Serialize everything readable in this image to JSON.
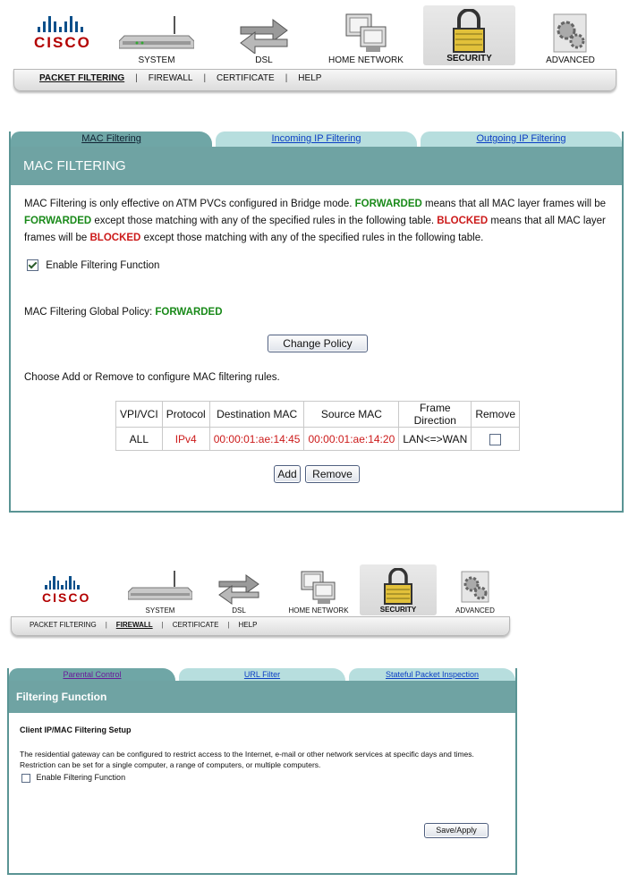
{
  "top": {
    "logo": {
      "icon": "cisco-logo-icon",
      "word": "CISCO"
    },
    "nav": [
      {
        "label": "SYSTEM",
        "icon": "router-icon"
      },
      {
        "label": "DSL",
        "icon": "arrows-icon"
      },
      {
        "label": "HOME NETWORK",
        "icon": "computers-icon"
      },
      {
        "label": "SECURITY",
        "icon": "padlock-icon"
      },
      {
        "label": "ADVANCED",
        "icon": "gears-icon"
      }
    ],
    "subnav": [
      "PACKET FILTERING",
      "FIREWALL",
      "CERTIFICATE",
      "HELP"
    ],
    "subnav_active": "PACKET FILTERING",
    "tabs": [
      "MAC Filtering",
      "Incoming IP Filtering",
      "Outgoing IP Filtering"
    ],
    "title": "MAC FILTERING",
    "description": {
      "p1": "MAC Filtering is only effective on ATM PVCs configured in Bridge mode. ",
      "fwd1": "FORWARDED",
      "p2": " means that all MAC layer frames will be ",
      "fwd2": "FORWARDED",
      "p3": " except those matching with any of the specified rules in the following table. ",
      "blk1": "BLOCKED",
      "p4": " means that all MAC layer frames will be ",
      "blk2": "BLOCKED",
      "p5": " except those matching with any of the specified rules in the following table."
    },
    "enable_label": "Enable Filtering Function",
    "enable_checked": true,
    "policy_label": "MAC Filtering Global Policy: ",
    "policy_value": "FORWARDED",
    "change_policy_button": "Change Policy",
    "choose_text": "Choose Add or Remove to configure MAC filtering rules.",
    "table": {
      "headers": [
        "VPI/VCI",
        "Protocol",
        "Destination MAC",
        "Source MAC",
        "Frame Direction",
        "Remove"
      ],
      "rows": [
        {
          "vpi_vci": "ALL",
          "protocol": "IPv4",
          "dest_mac": "00:00:01:ae:14:45",
          "src_mac": "00:00:01:ae:14:20",
          "direction": "LAN<=>WAN",
          "remove_checked": false
        }
      ]
    },
    "add_button": "Add",
    "remove_button": "Remove"
  },
  "bottom": {
    "logo": {
      "icon": "cisco-logo-icon",
      "word": "CISCO"
    },
    "nav": [
      {
        "label": "SYSTEM",
        "icon": "router-icon"
      },
      {
        "label": "DSL",
        "icon": "arrows-icon"
      },
      {
        "label": "HOME NETWORK",
        "icon": "computers-icon"
      },
      {
        "label": "SECURITY",
        "icon": "padlock-icon"
      },
      {
        "label": "ADVANCED",
        "icon": "gears-icon"
      }
    ],
    "subnav": [
      "PACKET FILTERING",
      "FIREWALL",
      "CERTIFICATE",
      "HELP"
    ],
    "subnav_active": "FIREWALL",
    "tabs": [
      "Parental Control",
      "URL Filter",
      "Stateful Packet Inspection"
    ],
    "title": "Filtering Function",
    "section_heading": "Client IP/MAC Filtering Setup",
    "description": "The residential gateway can be configured to restrict access to the Internet, e-mail or other network services at specific days and times. Restriction can be set for a single computer, a range of computers, or multiple computers.",
    "enable_label": "Enable Filtering Function",
    "enable_checked": false,
    "save_button": "Save/Apply"
  },
  "colors": {
    "tab_active": "#6fa6a6",
    "tab_inactive": "#b7dede",
    "panel_border": "#5a9494",
    "forwarded": "#1a8a1a",
    "blocked": "#cc1a1a",
    "cisco_red": "#b30000",
    "cisco_blue": "#0a4f8a"
  }
}
